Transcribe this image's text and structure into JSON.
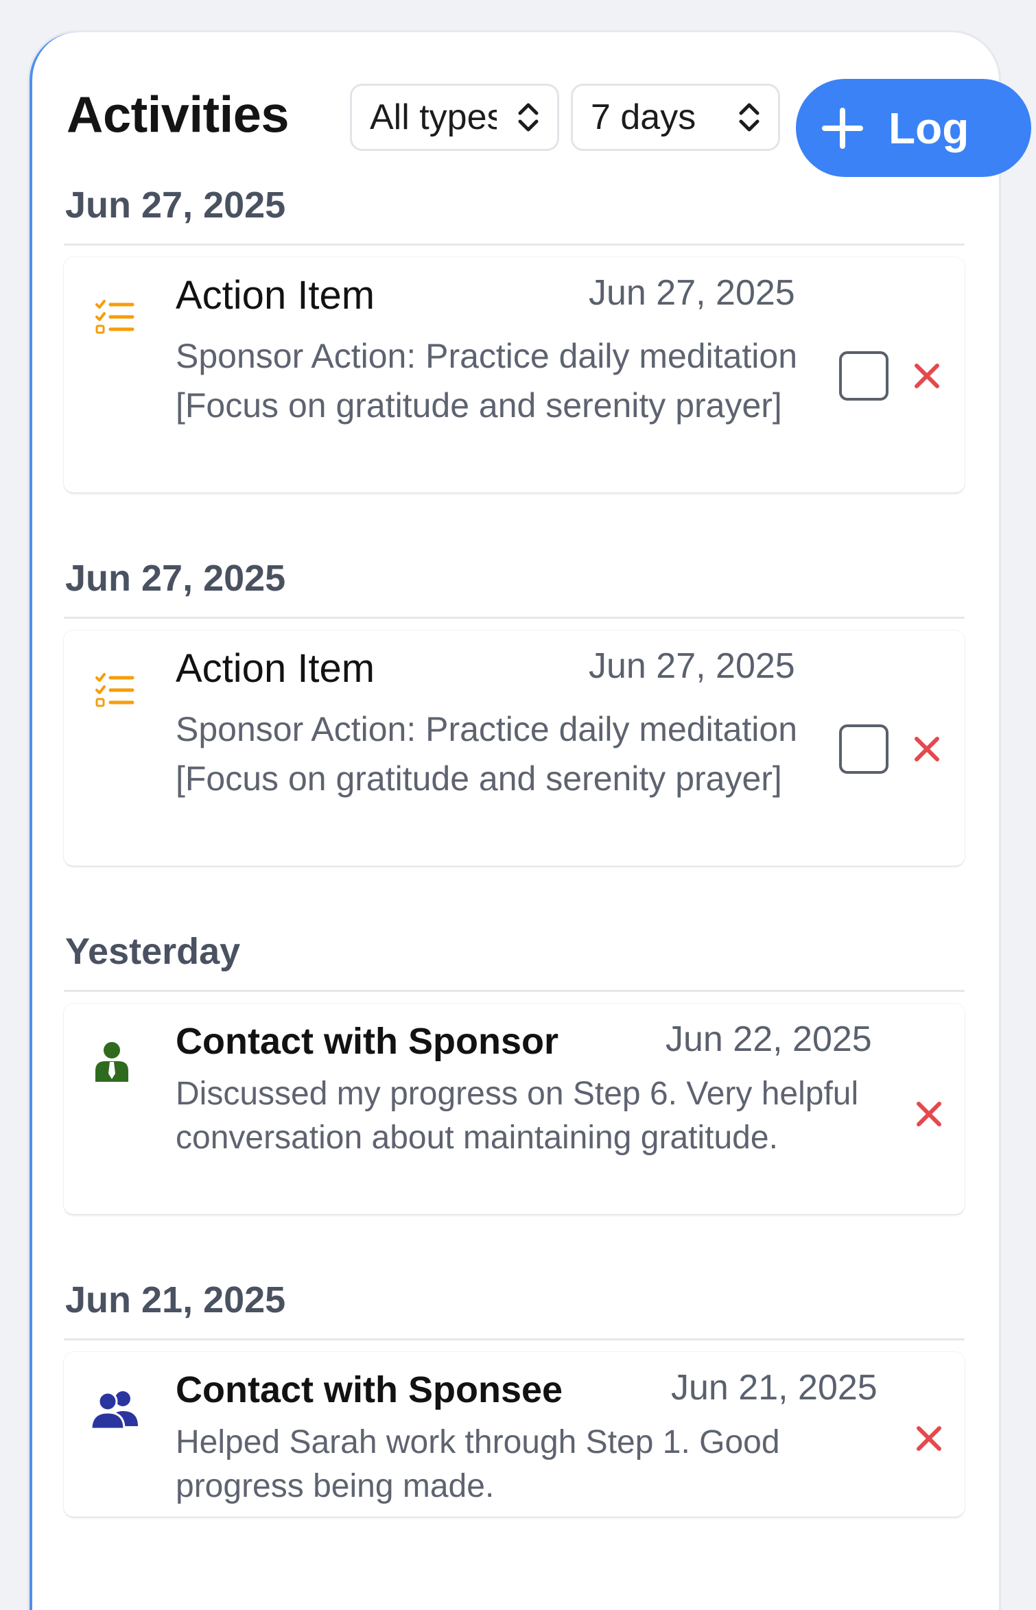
{
  "header": {
    "title": "Activities",
    "type_filter": "All types",
    "range_filter": "7 days",
    "log_label": "Log"
  },
  "colors": {
    "accent": "#3b82f6",
    "action_icon": "#f59e0b",
    "sponsor_icon": "#2f6b1e",
    "sponsee_icon": "#2b35a0",
    "delete": "#e5484d"
  },
  "groups": [
    {
      "heading": "Jun 27, 2025",
      "entries": [
        {
          "icon": "checklist-icon",
          "title": "Action Item",
          "date": "Jun 27, 2025",
          "description": "Sponsor Action: Practice daily meditation [Focus on gratitude and serenity prayer]",
          "checked": false
        }
      ]
    },
    {
      "heading": "Jun 27, 2025",
      "entries": [
        {
          "icon": "checklist-icon",
          "title": "Action Item",
          "date": "Jun 27, 2025",
          "description": "Sponsor Action: Practice daily meditation [Focus on gratitude and serenity prayer]",
          "checked": false
        }
      ]
    },
    {
      "heading": "Yesterday",
      "entries": [
        {
          "icon": "person-tie-icon",
          "title": "Contact with Sponsor",
          "date": "Jun 22, 2025",
          "description": "Discussed my progress on Step 6. Very helpful conversation about maintaining gratitude."
        }
      ]
    },
    {
      "heading": "Jun 21, 2025",
      "entries": [
        {
          "icon": "user-group-icon",
          "title": "Contact with Sponsee",
          "date": "Jun 21, 2025",
          "description": "Helped Sarah work through Step 1. Good progress being made."
        }
      ]
    }
  ]
}
